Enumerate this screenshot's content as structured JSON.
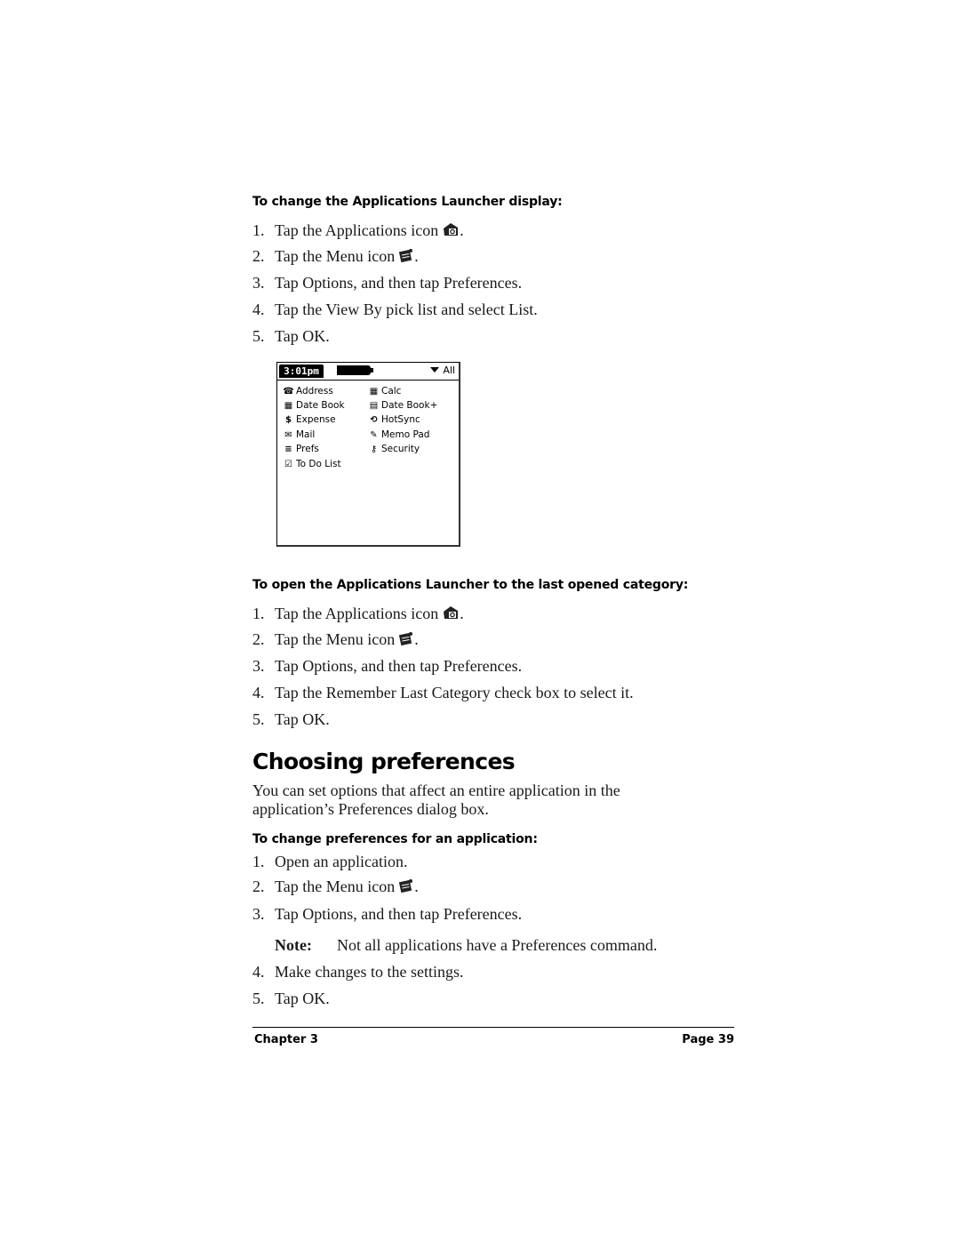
{
  "section1": {
    "heading": "To change the Applications Launcher display:",
    "steps": [
      {
        "num": "1.",
        "text": "Tap the Applications icon",
        "icon": "applications-icon",
        "after": "."
      },
      {
        "num": "2.",
        "text": "Tap the Menu icon",
        "icon": "menu-icon",
        "after": "."
      },
      {
        "num": "3.",
        "text": "Tap Options, and then tap Preferences."
      },
      {
        "num": "4.",
        "text": "Tap the View By pick list and select List."
      },
      {
        "num": "5.",
        "text": "Tap OK."
      }
    ]
  },
  "palm_screen": {
    "time": "3:01pm",
    "category": "All",
    "apps_left": [
      {
        "label": "Address",
        "icon": "phone-icon",
        "glyph": "☎"
      },
      {
        "label": "Date Book",
        "icon": "datebook-icon",
        "glyph": "▦"
      },
      {
        "label": "Expense",
        "icon": "dollar-icon",
        "glyph": "$"
      },
      {
        "label": "Mail",
        "icon": "mail-icon",
        "glyph": "✉"
      },
      {
        "label": "Prefs",
        "icon": "prefs-icon",
        "glyph": "≡"
      },
      {
        "label": "To Do List",
        "icon": "checkbox-icon",
        "glyph": "☑"
      }
    ],
    "apps_right": [
      {
        "label": "Calc",
        "icon": "calculator-icon",
        "glyph": "▦"
      },
      {
        "label": "Date Book+",
        "icon": "datebook-plus-icon",
        "glyph": "▤"
      },
      {
        "label": "HotSync",
        "icon": "hotsync-icon",
        "glyph": "⟲"
      },
      {
        "label": "Memo Pad",
        "icon": "memo-icon",
        "glyph": "✎"
      },
      {
        "label": "Security",
        "icon": "key-icon",
        "glyph": "⚷"
      }
    ]
  },
  "section2": {
    "heading": "To open the Applications Launcher to the last opened category:",
    "steps": [
      {
        "num": "1.",
        "text": "Tap the Applications icon",
        "icon": "applications-icon",
        "after": "."
      },
      {
        "num": "2.",
        "text": "Tap the Menu icon",
        "icon": "menu-icon",
        "after": "."
      },
      {
        "num": "3.",
        "text": "Tap Options, and then tap Preferences."
      },
      {
        "num": "4.",
        "text": "Tap the Remember Last Category check box to select it."
      },
      {
        "num": "5.",
        "text": "Tap OK."
      }
    ]
  },
  "section3": {
    "title": "Choosing preferences",
    "intro": "You can set options that affect an entire application in the application’s Preferences dialog box.",
    "heading": "To change preferences for an application:",
    "steps": [
      {
        "num": "1.",
        "text": "Open an application."
      },
      {
        "num": "2.",
        "text": "Tap the Menu icon",
        "icon": "menu-icon",
        "after": "."
      },
      {
        "num": "3.",
        "text": "Tap Options, and then tap Preferences."
      }
    ],
    "note_label": "Note:",
    "note_text": "Not all applications have a Preferences command.",
    "steps_after": [
      {
        "num": "4.",
        "text": "Make changes to the settings."
      },
      {
        "num": "5.",
        "text": "Tap OK."
      }
    ]
  },
  "footer": {
    "chapter": "Chapter 3",
    "page": "Page 39"
  }
}
